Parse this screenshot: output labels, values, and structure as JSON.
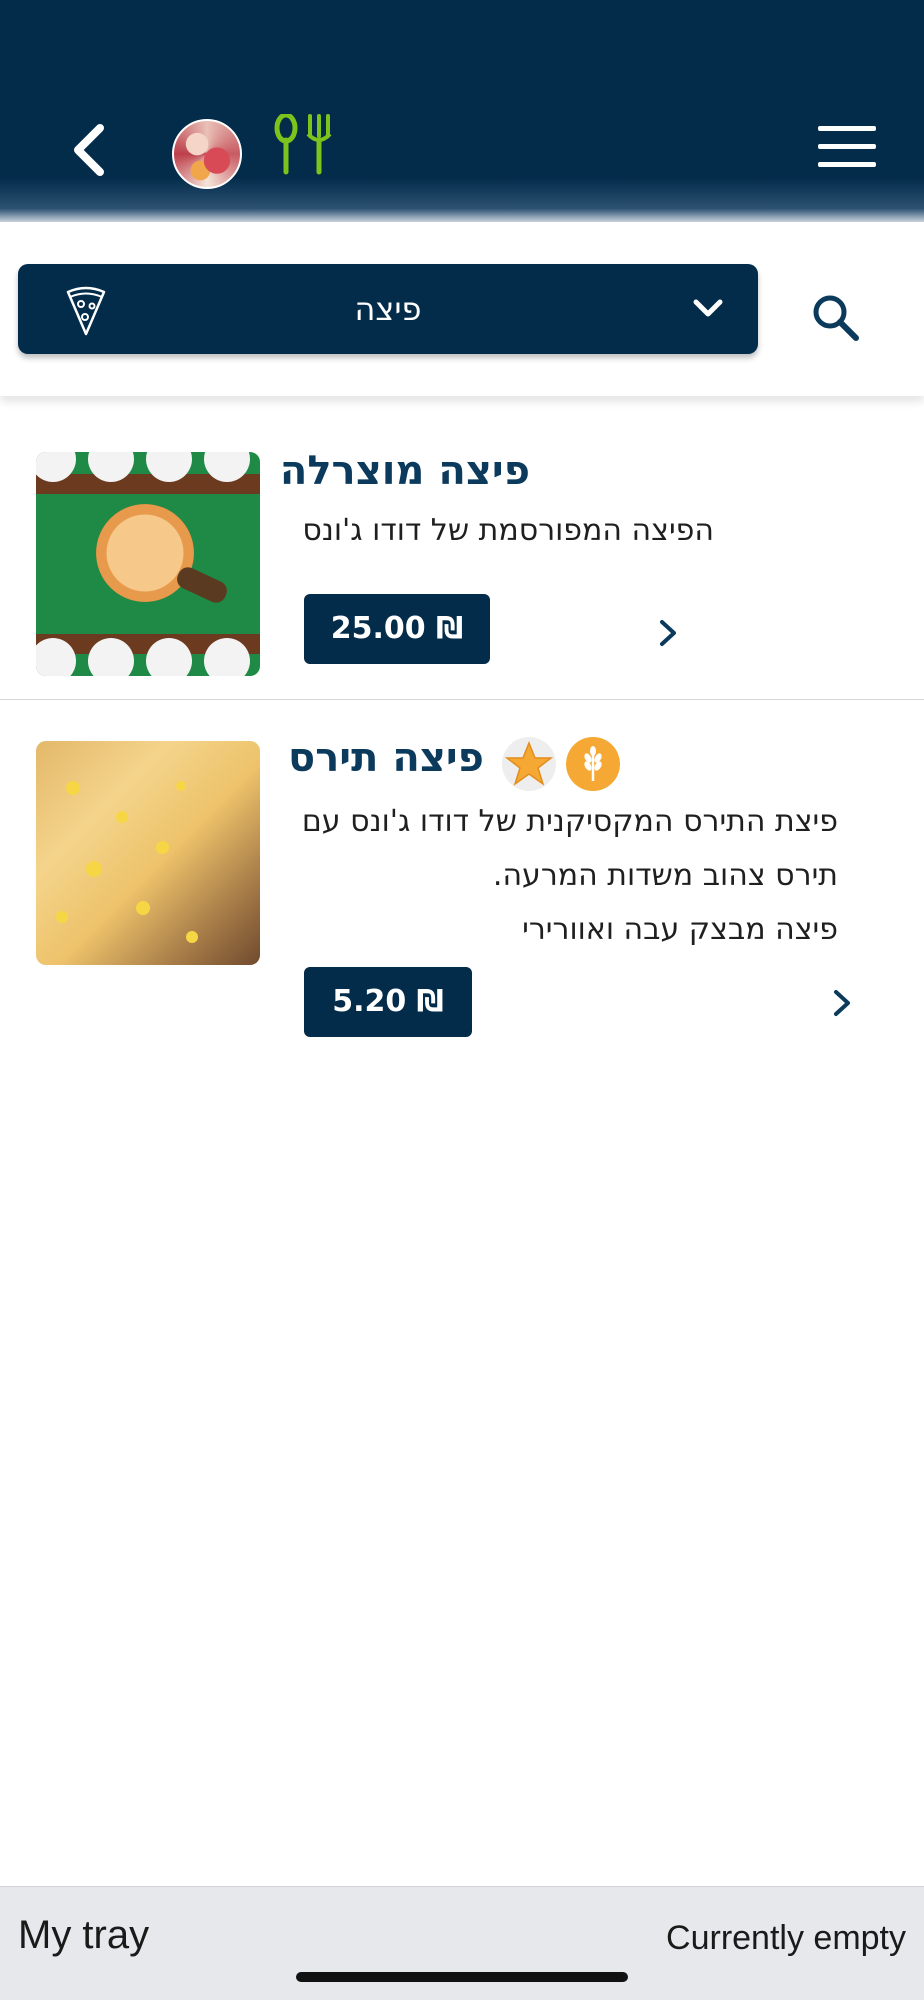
{
  "header": {
    "back_icon": "chevron-left-icon",
    "avatar_icon": "restaurant-avatar",
    "utensils_icon": "utensils-icon",
    "menu_icon": "hamburger-menu-icon",
    "background_color": "#032b4a",
    "accent_color": "#7cc31c"
  },
  "filter": {
    "category_label": "פיצה",
    "category_icon": "pizza-slice-icon",
    "dropdown_icon": "chevron-down-icon",
    "search_icon": "search-icon"
  },
  "items": [
    {
      "title": "פיצה מוצרלה",
      "description_lines": [
        "הפיצה המפורסמת של דודו ג'ונס"
      ],
      "price": "25.00 ₪",
      "badges": []
    },
    {
      "title": "פיצה תירס",
      "description_lines": [
        "פיצת התירס המקסיקנית של דודו ג'ונס עם",
        "תירס צהוב משדות המרעה.",
        "פיצה מבצק עבה ואוורירי"
      ],
      "price": "5.20 ₪",
      "badges": [
        "star-icon",
        "wheat-icon"
      ]
    }
  ],
  "tray": {
    "title": "My tray",
    "status": "Currently empty"
  }
}
